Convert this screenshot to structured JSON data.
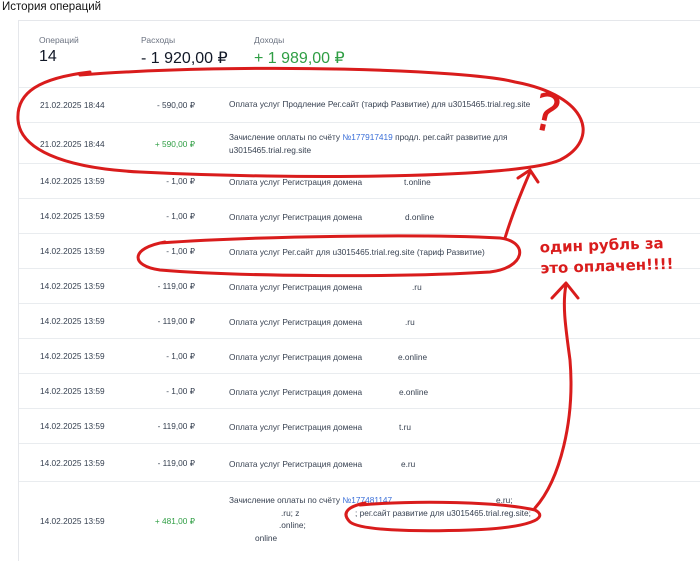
{
  "page_title": "История операций",
  "summary": {
    "operations": {
      "label": "Операций",
      "value": "14"
    },
    "expenses": {
      "label": "Расходы",
      "value": "- 1 920,00 ₽"
    },
    "income": {
      "label": "Доходы",
      "value": "+ 1 989,00 ₽"
    }
  },
  "rows": [
    {
      "date": "21.02.2025 18:44",
      "amount": "- 590,00 ₽",
      "desc1": "Оплата услуг Продление Рег.сайт (тариф Развитие) для u3015465.trial.reg.site"
    },
    {
      "date": "21.02.2025 18:44",
      "amount": "+ 590,00 ₽",
      "desc1_prefix": "Зачисление оплаты по счёту ",
      "desc1_link": "№177917419",
      "desc1_suffix": " продл. рег.сайт развитие для",
      "desc2": "u3015465.trial.reg.site"
    },
    {
      "date": "14.02.2025 13:59",
      "amount": "- 1,00 ₽",
      "desc1": "Оплата услуг Регистрация домена",
      "desc_tail": "t.online"
    },
    {
      "date": "14.02.2025 13:59",
      "amount": "- 1,00 ₽",
      "desc1": "Оплата услуг Регистрация домена",
      "desc_tail": "d.online"
    },
    {
      "date": "14.02.2025 13:59",
      "amount": "- 1,00 ₽",
      "desc1": "Оплата услуг Рег.сайт для u3015465.trial.reg.site (тариф Развитие)"
    },
    {
      "date": "14.02.2025 13:59",
      "amount": "- 119,00 ₽",
      "desc1": "Оплата услуг Регистрация домена",
      "desc_tail": ".ru"
    },
    {
      "date": "14.02.2025 13:59",
      "amount": "- 119,00 ₽",
      "desc1": "Оплата услуг Регистрация домена",
      "desc_tail": ".ru"
    },
    {
      "date": "14.02.2025 13:59",
      "amount": "- 1,00 ₽",
      "desc1": "Оплата услуг Регистрация домена",
      "desc_tail": "e.online"
    },
    {
      "date": "14.02.2025 13:59",
      "amount": "- 1,00 ₽",
      "desc1": "Оплата услуг Регистрация домена",
      "desc_tail": "e.online"
    },
    {
      "date": "14.02.2025 13:59",
      "amount": "- 119,00 ₽",
      "desc1": "Оплата услуг Регистрация домена",
      "desc_tail": "t.ru"
    },
    {
      "date": "14.02.2025 13:59",
      "amount": "- 119,00 ₽",
      "desc1": "Оплата услуг Регистрация домена",
      "desc_tail": "e.ru"
    },
    {
      "date": "14.02.2025 13:59",
      "amount": "+ 481,00 ₽",
      "desc1_prefix": "Зачисление оплаты по счёту ",
      "desc1_link": "№177481147",
      "desc1_tail": "e.ru;",
      "desc2a": ".ru; z",
      "desc2b": "; рег.сайт развитие для u3015465.trial.reg.site;",
      "desc3": ".online;",
      "desc4": "online"
    }
  ],
  "annotation": {
    "note": "один рубль за это оплачен!!!!",
    "question": "?"
  },
  "colors": {
    "annotation_red": "#d91c1c",
    "income_green": "#2f9e44",
    "link_blue": "#3b6fd8"
  }
}
